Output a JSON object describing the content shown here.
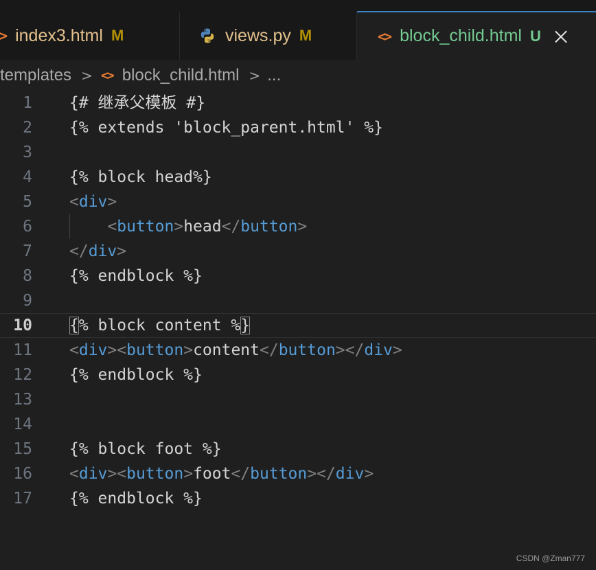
{
  "tabs": [
    {
      "icon": "<>",
      "label": "index3.html",
      "badge": "M",
      "state": "modified"
    },
    {
      "icon": "python-icon",
      "label": "views.py",
      "badge": "M",
      "state": "modified"
    },
    {
      "icon": "<>",
      "label": "block_child.html",
      "badge": "U",
      "state": "untracked",
      "active": true
    }
  ],
  "breadcrumb": {
    "folder": "templates",
    "sep": ">",
    "icon": "<>",
    "file": "block_child.html",
    "ellipsis": "..."
  },
  "editor": {
    "current_line": 10,
    "lines": [
      {
        "n": "1",
        "tokens": [
          [
            "tpl",
            "{# 继承父模板 #}"
          ]
        ]
      },
      {
        "n": "2",
        "tokens": [
          [
            "tpl",
            "{% extends 'block_parent.html' %}"
          ]
        ]
      },
      {
        "n": "3",
        "tokens": []
      },
      {
        "n": "4",
        "tokens": [
          [
            "tpl",
            "{% block head%}"
          ]
        ]
      },
      {
        "n": "5",
        "tokens": [
          [
            "punc",
            "<"
          ],
          [
            "tag",
            "div"
          ],
          [
            "punc",
            ">"
          ]
        ]
      },
      {
        "n": "6",
        "indent": true,
        "tokens": [
          [
            "text",
            "    "
          ],
          [
            "punc",
            "<"
          ],
          [
            "tag",
            "button"
          ],
          [
            "punc",
            ">"
          ],
          [
            "text",
            "head"
          ],
          [
            "punc",
            "</"
          ],
          [
            "tag",
            "button"
          ],
          [
            "punc",
            ">"
          ]
        ]
      },
      {
        "n": "7",
        "tokens": [
          [
            "punc",
            "</"
          ],
          [
            "tag",
            "div"
          ],
          [
            "punc",
            ">"
          ]
        ]
      },
      {
        "n": "8",
        "tokens": [
          [
            "tpl",
            "{% endblock %}"
          ]
        ]
      },
      {
        "n": "9",
        "tokens": []
      },
      {
        "n": "10",
        "tokens": [
          [
            "box",
            "{"
          ],
          [
            "tpl",
            "% block content %"
          ],
          [
            "box",
            "}"
          ]
        ]
      },
      {
        "n": "11",
        "tokens": [
          [
            "punc",
            "<"
          ],
          [
            "tag",
            "div"
          ],
          [
            "punc",
            "><"
          ],
          [
            "tag",
            "button"
          ],
          [
            "punc",
            ">"
          ],
          [
            "text",
            "content"
          ],
          [
            "punc",
            "</"
          ],
          [
            "tag",
            "button"
          ],
          [
            "punc",
            "></"
          ],
          [
            "tag",
            "div"
          ],
          [
            "punc",
            ">"
          ]
        ]
      },
      {
        "n": "12",
        "tokens": [
          [
            "tpl",
            "{% endblock %}"
          ]
        ]
      },
      {
        "n": "13",
        "tokens": []
      },
      {
        "n": "14",
        "tokens": []
      },
      {
        "n": "15",
        "tokens": [
          [
            "tpl",
            "{% block foot %}"
          ]
        ]
      },
      {
        "n": "16",
        "tokens": [
          [
            "punc",
            "<"
          ],
          [
            "tag",
            "div"
          ],
          [
            "punc",
            "><"
          ],
          [
            "tag",
            "button"
          ],
          [
            "punc",
            ">"
          ],
          [
            "text",
            "foot"
          ],
          [
            "punc",
            "</"
          ],
          [
            "tag",
            "button"
          ],
          [
            "punc",
            "></"
          ],
          [
            "tag",
            "div"
          ],
          [
            "punc",
            ">"
          ]
        ]
      },
      {
        "n": "17",
        "tokens": [
          [
            "tpl",
            "{% endblock %}"
          ]
        ]
      }
    ]
  },
  "watermark": "CSDN @Zman777",
  "colors": {
    "tag": "#569cd6",
    "punctuation": "#808080",
    "text": "#d4d4d4",
    "modified": "#e2c08d",
    "untracked": "#73c991",
    "html_icon": "#e37933",
    "active_tab_border": "#3b82c4"
  }
}
